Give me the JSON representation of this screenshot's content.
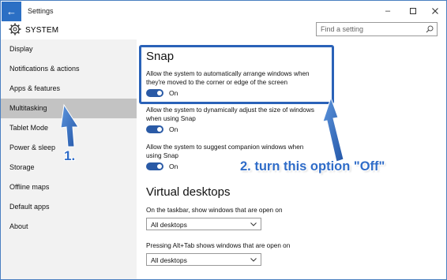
{
  "window": {
    "title": "Settings"
  },
  "header": {
    "section": "SYSTEM",
    "search_placeholder": "Find a setting"
  },
  "sidebar": {
    "items": [
      {
        "label": "Display"
      },
      {
        "label": "Notifications & actions"
      },
      {
        "label": "Apps & features"
      },
      {
        "label": "Multitasking",
        "selected": true
      },
      {
        "label": "Tablet Mode"
      },
      {
        "label": "Power & sleep"
      },
      {
        "label": "Storage"
      },
      {
        "label": "Offline maps"
      },
      {
        "label": "Default apps"
      },
      {
        "label": "About"
      }
    ]
  },
  "main": {
    "snap": {
      "title": "Snap",
      "option1": {
        "text": "Allow the system to automatically arrange windows when they're moved to the corner or edge of the screen",
        "state": "On"
      },
      "option2": {
        "text": "Allow the system to dynamically adjust the size of windows when using Snap",
        "state": "On"
      },
      "option3": {
        "text": "Allow the system to suggest companion windows when using Snap",
        "state": "On"
      }
    },
    "virtual_desktops": {
      "title": "Virtual desktops",
      "taskbar_label": "On the taskbar, show windows that are open on",
      "taskbar_value": "All desktops",
      "alttab_label": "Pressing Alt+Tab shows windows that are open on",
      "alttab_value": "All desktops"
    }
  },
  "annotations": {
    "step1": "1.",
    "step2": "2. turn this option \"Off\""
  },
  "colors": {
    "accent": "#2b6fc4",
    "toggle_on": "#2a5aa6",
    "annotation": "#2f6cc8",
    "sidebar_bg": "#f2f2f2",
    "sidebar_selected": "#c3c3c3"
  }
}
